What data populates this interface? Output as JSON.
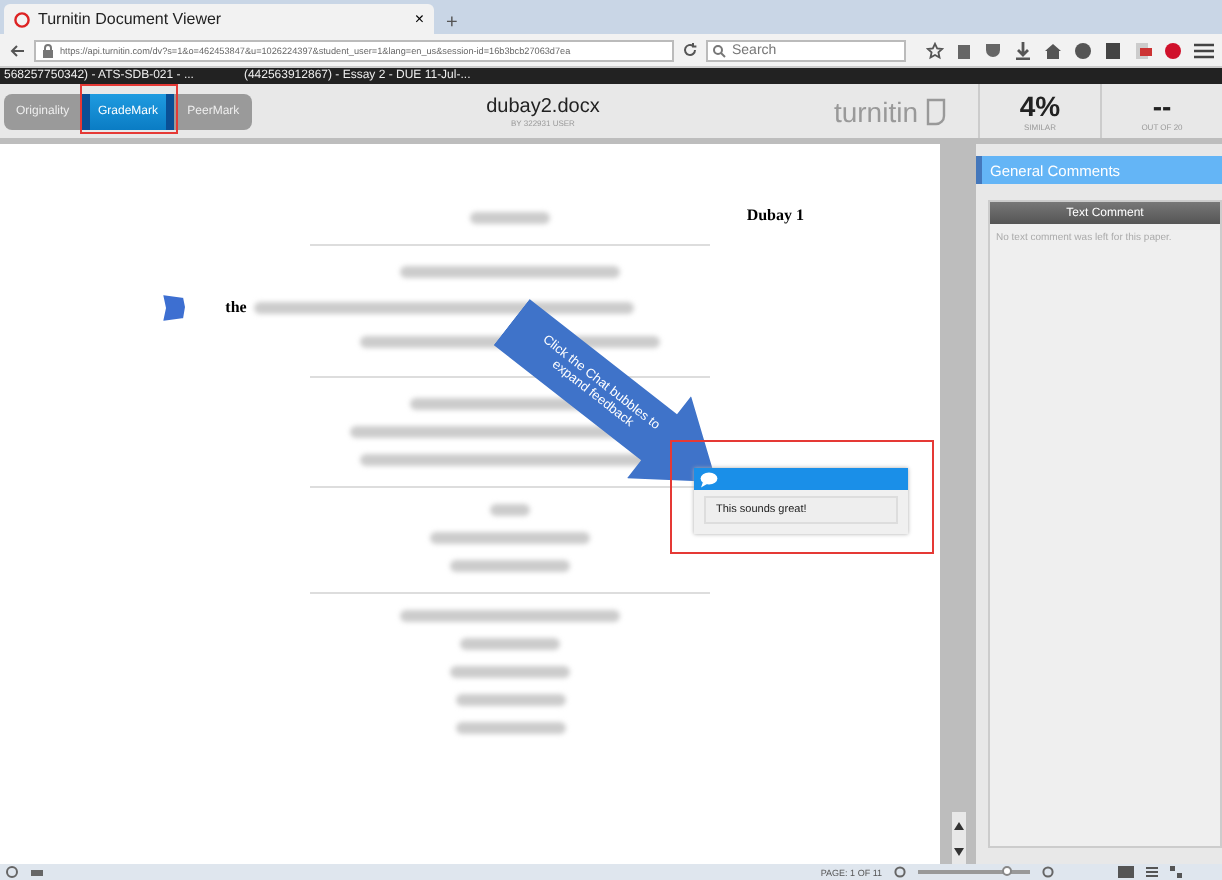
{
  "browser": {
    "tab_title": "Turnitin Document Viewer",
    "tab_close": "×",
    "new_tab": "+",
    "url": "https://api.turnitin.com/dv?s=1&o=462453847&u=1026224397&student_user=1&lang=en_us&session-id=16b3bcb27063d7ea",
    "search_placeholder": "Search"
  },
  "assignment_strip": [
    "568257750342) - ATS-SDB-021 - ...",
    "(442563912867) - Essay 2 - DUE 11-Jul-..."
  ],
  "toolbar": {
    "modes": [
      {
        "label": "Originality",
        "selected": false
      },
      {
        "label": "GradeMark",
        "selected": true
      },
      {
        "label": "PeerMark",
        "selected": false
      }
    ],
    "file_name": "dubay2.docx",
    "author": "BY 322931 USER",
    "logo": "turnitin",
    "similarity": "4%",
    "similarity_label": "SIMILAR",
    "grade": "--",
    "grade_label": "OUT OF 20"
  },
  "document": {
    "header": "Dubay 1",
    "word": "the",
    "callout": "Click the Chat bubbles to expand feedback",
    "comment": "This sounds great!"
  },
  "general_comments": {
    "title": "General Comments",
    "tab": "Text Comment",
    "empty_text": "No text comment was left for this paper."
  },
  "status_bar": {
    "page": "PAGE: 1 OF 11",
    "zoom": {
      "level": 0.8
    }
  }
}
